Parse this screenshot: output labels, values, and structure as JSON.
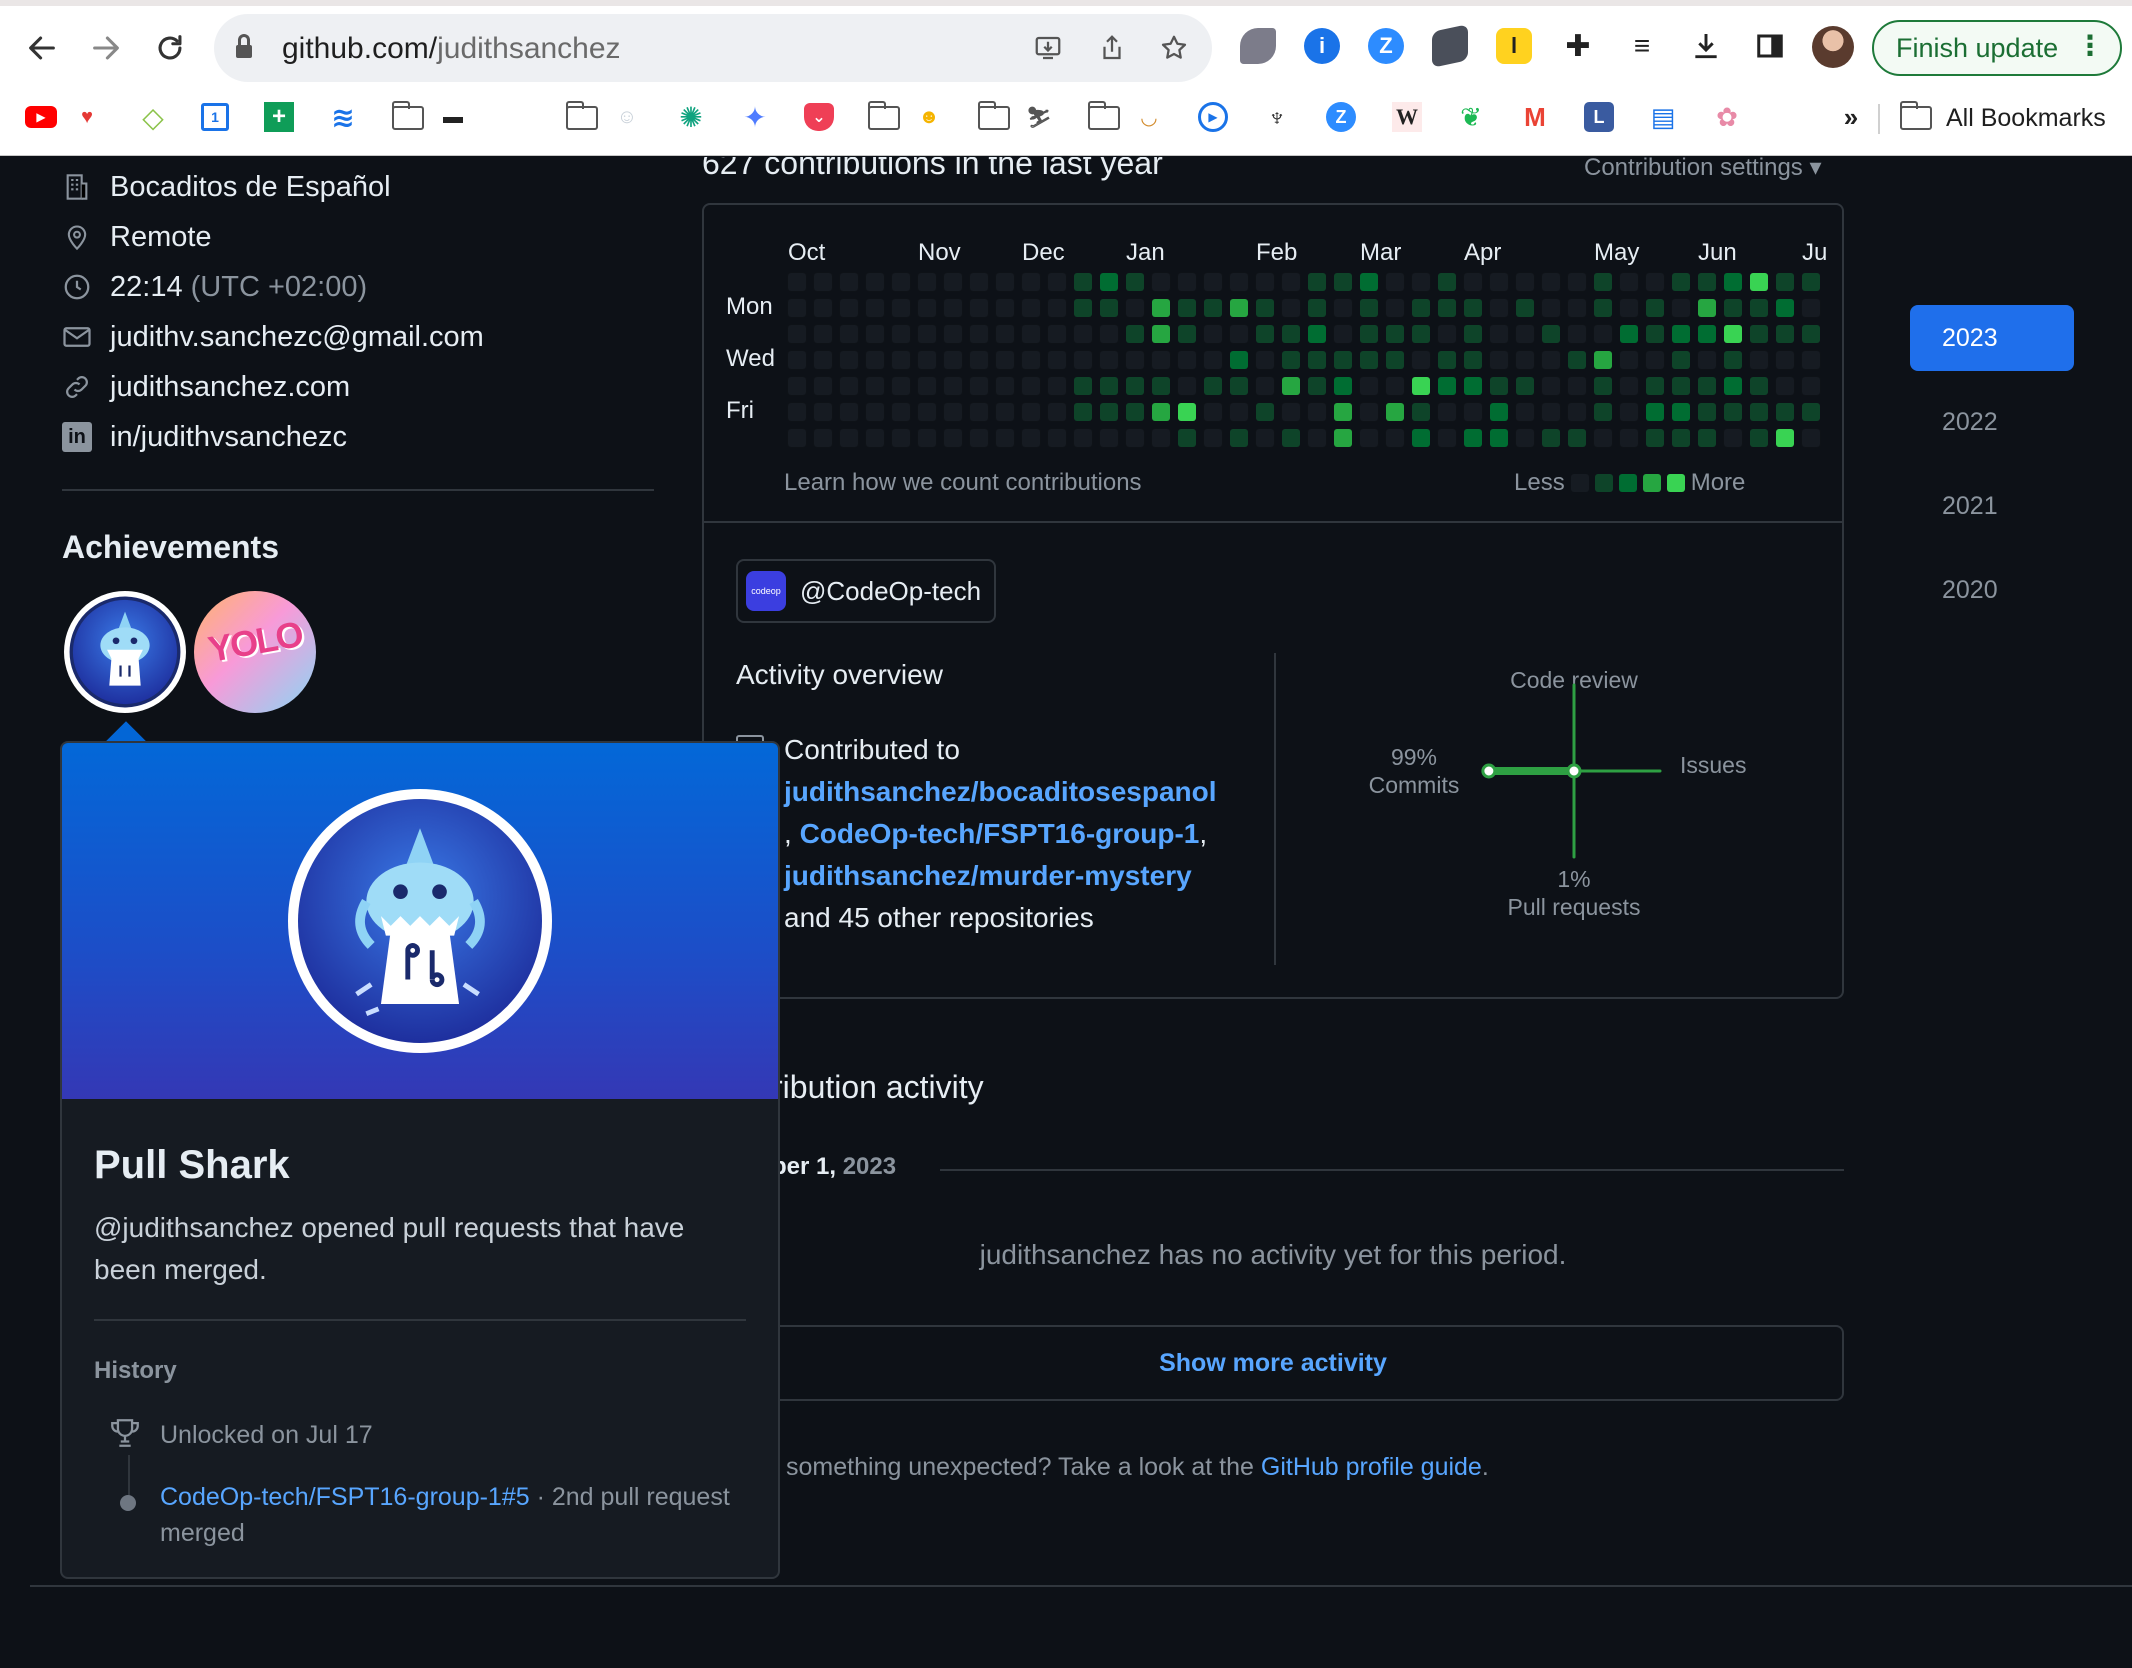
{
  "browser": {
    "url_host": "github.com/",
    "url_path": "judithsanchez",
    "finish_update_label": "Finish update",
    "all_bookmarks_label": "All Bookmarks",
    "overflow_label": "»"
  },
  "profile": {
    "company": "Bocaditos de Español",
    "location": "Remote",
    "local_time": "22:14",
    "timezone": "(UTC +02:00)",
    "email": "judithv.sanchezc@gmail.com",
    "website": "judithsanchez.com",
    "linkedin": "in/judithvsanchezc"
  },
  "achievements": {
    "title": "Achievements",
    "popover": {
      "title": "Pull Shark",
      "description": "@judithsanchez opened pull requests that have been merged.",
      "history_label": "History",
      "unlocked": "Unlocked on Jul 17",
      "event_link": "CodeOp-tech/FSPT16-group-1#5",
      "event_rest": " · 2nd pull request merged"
    },
    "badge2_text": "YOLO"
  },
  "contributions": {
    "title": "627 contributions in the last year",
    "settings_label": "Contribution settings ▾",
    "months": [
      "Oct",
      "Nov",
      "Dec",
      "Jan",
      "Feb",
      "Mar",
      "Apr",
      "May",
      "Jun",
      "Ju"
    ],
    "days": [
      "Mon",
      "Wed",
      "Fri"
    ],
    "learn_label": "Learn how we count contributions",
    "legend_less": "Less",
    "legend_more": "More",
    "level_colors": [
      "#161b22",
      "#0e4429",
      "#006d32",
      "#26a641",
      "#39d353"
    ]
  },
  "activity": {
    "org": "@CodeOp-tech",
    "org_logo_text": "codeop",
    "overview_title": "Activity overview",
    "contributed_to": "Contributed to",
    "repo1": "judithsanchez/bocaditosespanol",
    "repo2": "CodeOp-tech/FSPT16-group-1",
    "repo3": "judithsanchez/murder-mystery",
    "sep1": ", ",
    "sep2": ",",
    "others": "and 45 other repositories",
    "graph": {
      "code_review": "Code review",
      "issues": "Issues",
      "commits_pct": "99%",
      "commits": "Commits",
      "pr_pct": "1%",
      "pull_requests": "Pull requests",
      "commits_value": 99,
      "pull_requests_value": 1,
      "code_review_value": 0,
      "issues_value": 0
    }
  },
  "contribution_activity": {
    "title": "ribution activity",
    "period": "ber 1, ",
    "period_year": "2023",
    "no_activity": "judithsanchez has no activity yet for this period.",
    "show_more": "Show more activity",
    "footer_text": " something unexpected? Take a look at the ",
    "footer_link": "GitHub profile guide",
    "footer_end": "."
  },
  "years": [
    "2023",
    "2022",
    "2021",
    "2020"
  ]
}
